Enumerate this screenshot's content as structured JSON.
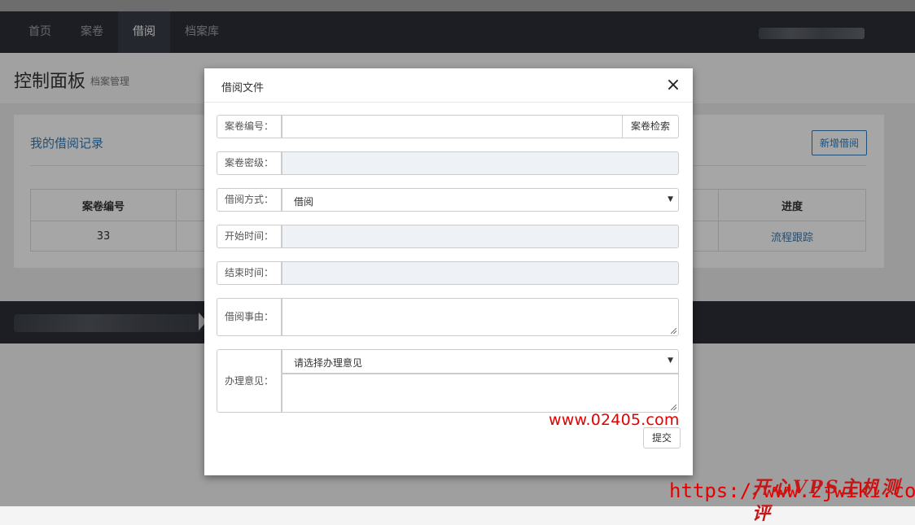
{
  "navbar": {
    "items": [
      {
        "label": "首页"
      },
      {
        "label": "案卷"
      },
      {
        "label": "借阅"
      },
      {
        "label": "档案库"
      }
    ],
    "active_index": 2
  },
  "header": {
    "title": "控制面板",
    "subtitle": "档案管理"
  },
  "panel": {
    "title": "我的借阅记录",
    "new_button": "新增借阅",
    "table": {
      "headers": [
        "案卷编号",
        "",
        "",
        "进度"
      ],
      "rows": [
        [
          "33",
          "",
          "",
          "流程跟踪"
        ]
      ]
    }
  },
  "modal": {
    "title": "借阅文件",
    "close_glyph": "×",
    "fields": {
      "case_number": {
        "label": "案卷编号：",
        "value": "",
        "search_button": "案卷检索"
      },
      "case_secret": {
        "label": "案卷密级：",
        "value": ""
      },
      "borrow_method": {
        "label": "借阅方式：",
        "value": "借阅"
      },
      "start_time": {
        "label": "开始时间：",
        "value": ""
      },
      "end_time": {
        "label": "结束时间：",
        "value": ""
      },
      "reason": {
        "label": "借阅事由：",
        "value": ""
      },
      "opinion": {
        "label": "办理意见：",
        "select_value": "请选择办理意见",
        "text_value": ""
      }
    },
    "submit_button": "提交"
  },
  "watermarks": {
    "site1": "www.02405.com",
    "site2": "https://www.zjwiki.com",
    "site2_cn": "开心VPS主机测评"
  },
  "colors": {
    "navbar_bg": "#2b2f37",
    "link_blue": "#337ab7",
    "readonly_bg": "#eef1f5",
    "watermark_red": "#e60000"
  }
}
